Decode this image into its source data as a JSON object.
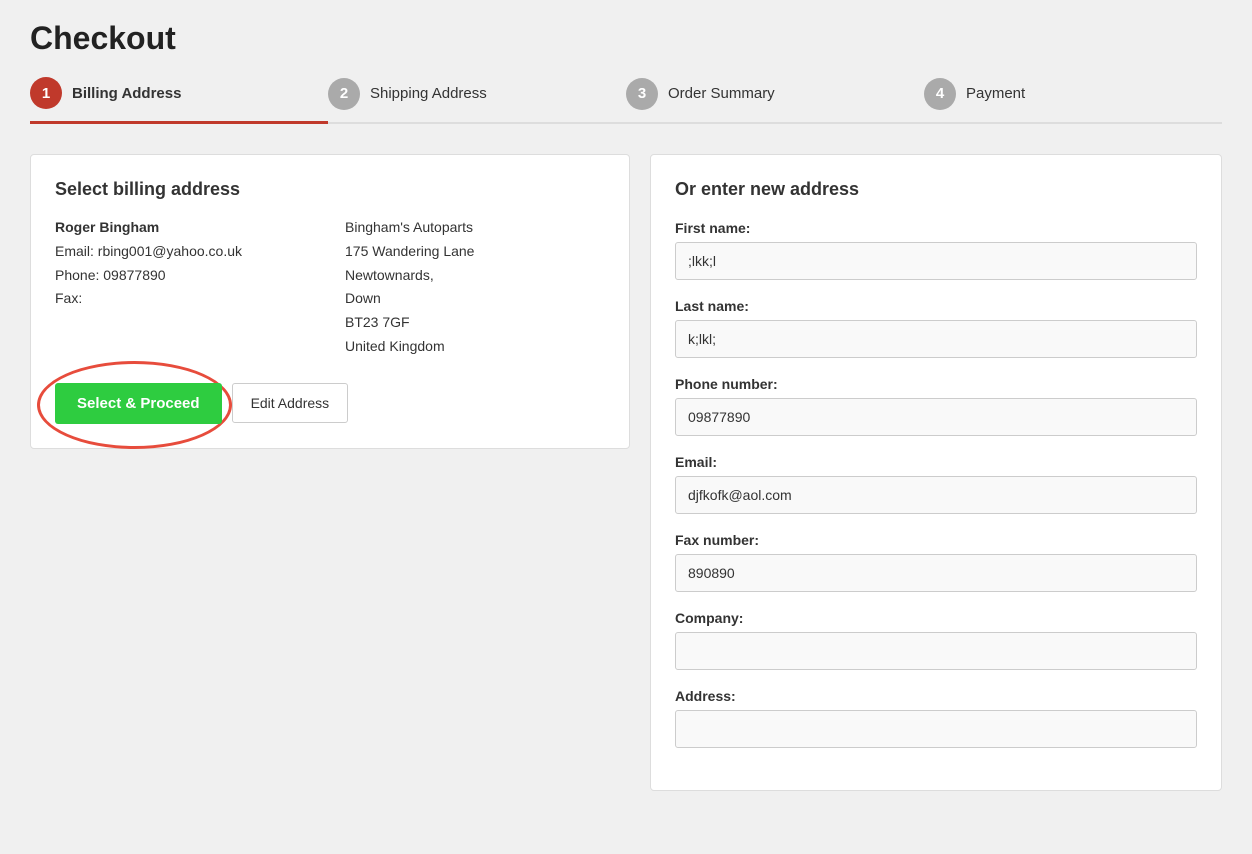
{
  "page": {
    "title": "Checkout"
  },
  "steps": [
    {
      "number": "1",
      "label": "Billing Address",
      "active": true
    },
    {
      "number": "2",
      "label": "Shipping Address",
      "active": false
    },
    {
      "number": "3",
      "label": "Order Summary",
      "active": false
    },
    {
      "number": "4",
      "label": "Payment",
      "active": false
    }
  ],
  "billing_section": {
    "title": "Select billing address",
    "name": "Roger Bingham",
    "email_label": "Email:",
    "email": "rbing001@yahoo.co.uk",
    "phone_label": "Phone:",
    "phone": "09877890",
    "fax_label": "Fax:",
    "company": "Bingham's Autoparts",
    "address_line1": "175 Wandering Lane",
    "address_line2": "Newtownards,",
    "address_line3": "Down",
    "address_line4": "BT23 7GF",
    "address_line5": "United Kingdom",
    "select_button": "Select & Proceed",
    "edit_button": "Edit Address"
  },
  "new_address_section": {
    "title": "Or enter new address",
    "fields": [
      {
        "label": "First name:",
        "value": ";lkk;l",
        "placeholder": ""
      },
      {
        "label": "Last name:",
        "value": "k;lkl;",
        "placeholder": ""
      },
      {
        "label": "Phone number:",
        "value": "09877890",
        "placeholder": ""
      },
      {
        "label": "Email:",
        "value": "djfkofk@aol.com",
        "placeholder": ""
      },
      {
        "label": "Fax number:",
        "value": "890890",
        "placeholder": ""
      },
      {
        "label": "Company:",
        "value": "",
        "placeholder": ""
      },
      {
        "label": "Address:",
        "value": "",
        "placeholder": ""
      }
    ]
  }
}
